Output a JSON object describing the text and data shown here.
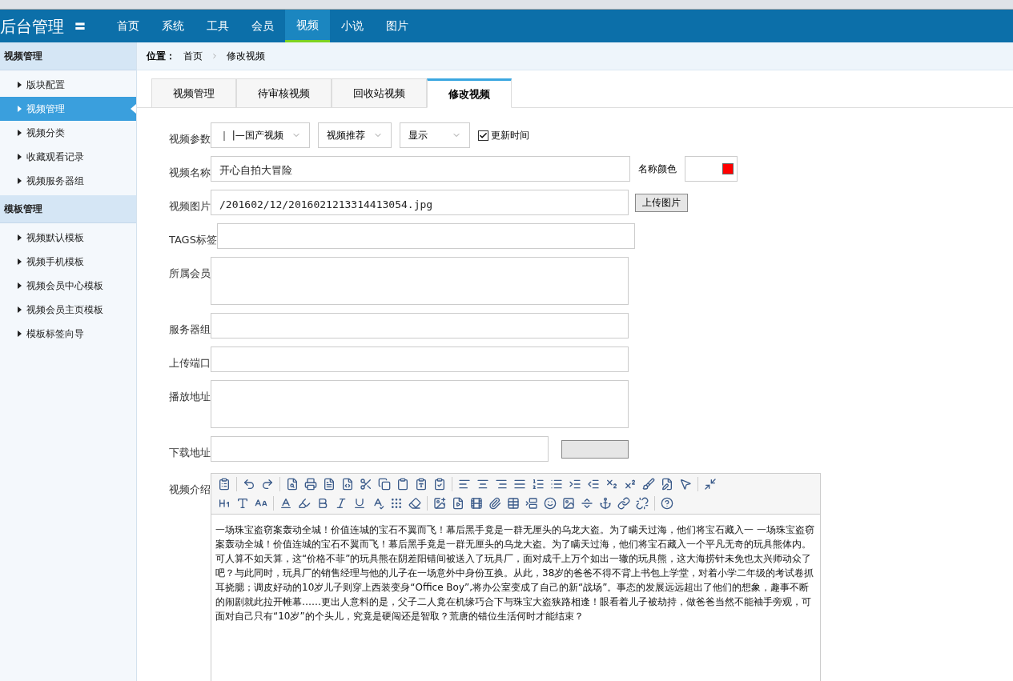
{
  "header": {
    "logo": "后台管理",
    "menu_glyph": "〓",
    "nav": [
      {
        "label": "首页",
        "selected": false
      },
      {
        "label": "系统",
        "selected": false
      },
      {
        "label": "工具",
        "selected": false
      },
      {
        "label": "会员",
        "selected": false
      },
      {
        "label": "视频",
        "selected": true
      },
      {
        "label": "小说",
        "selected": false
      },
      {
        "label": "图片",
        "selected": false
      }
    ]
  },
  "sidebar": [
    {
      "title": "视频管理",
      "items": [
        {
          "label": "版块配置",
          "selected": false
        },
        {
          "label": "视频管理",
          "selected": true
        },
        {
          "label": "视频分类",
          "selected": false
        },
        {
          "label": "收藏观看记录",
          "selected": false
        },
        {
          "label": "视频服务器组",
          "selected": false
        }
      ]
    },
    {
      "title": "模板管理",
      "items": [
        {
          "label": "视频默认模板",
          "selected": false
        },
        {
          "label": "视频手机模板",
          "selected": false
        },
        {
          "label": "视频会员中心模板",
          "selected": false
        },
        {
          "label": "视频会员主页模板",
          "selected": false
        },
        {
          "label": "模板标签向导",
          "selected": false
        }
      ]
    }
  ],
  "breadcrumb": {
    "label": "位置：",
    "items": [
      "首页",
      "修改视频"
    ]
  },
  "tabs": [
    {
      "label": "视频管理",
      "selected": false
    },
    {
      "label": "待审核视频",
      "selected": false
    },
    {
      "label": "回收站视频",
      "selected": false
    },
    {
      "label": "修改视频",
      "selected": true
    }
  ],
  "form": [
    {
      "kind": "selects",
      "label": "视频参数",
      "selects": [
        "｜ |—国产视频",
        "视频推荐",
        "显示"
      ],
      "checkbox": {
        "label": "更新时间",
        "checked": true
      }
    },
    {
      "kind": "color",
      "label": "视频名称",
      "value": "开心自拍大冒险",
      "color_label": "名称颜色",
      "color": "#ff0000"
    },
    {
      "kind": "upload",
      "label": "视频图片",
      "value": "/201602/12/2016021213314413054.jpg",
      "button": "上传图片"
    },
    {
      "kind": "text",
      "label": "TAGS标签"
    },
    {
      "kind": "tall",
      "label": "所属会员"
    },
    {
      "kind": "text",
      "label": "服务器组"
    },
    {
      "kind": "text",
      "label": "上传端口"
    },
    {
      "kind": "tall",
      "label": "播放地址"
    },
    {
      "kind": "download",
      "label": "下载地址"
    }
  ],
  "editor": {
    "label": "视频介绍",
    "content": "一场珠宝盗窃案轰动全城！价值连城的宝石不翼而飞！幕后黑手竟是一群无厘头的乌龙大盗。为了瞒天过海，他们将宝石藏入一 一场珠宝盗窃案轰动全城！价值连城的宝石不翼而飞！幕后黑手竟是一群无厘头的乌龙大盗。为了瞒天过海，他们将宝石藏入一个平凡无奇的玩具熊体内。可人算不如天算，这“价格不菲”的玩具熊在阴差阳错间被送入了玩具厂，面对成千上万个如出一辙的玩具熊，这大海捞针未免也太兴师动众了吧？与此同时，玩具厂的销售经理与他的儿子在一场意外中身份互换。从此，38岁的爸爸不得不背上书包上学堂，对着小学二年级的考试卷抓耳挠腮；调皮好动的10岁儿子则穿上西装变身“Office Boy”,将办公室变成了自己的新“战场”。事态的发展远远超出了他们的想象，趣事不断的闹剧就此拉开帷幕……更出人意料的是，父子二人竟在机缘巧合下与珠宝大盗狭路相逢！眼看着儿子被劫持，做爸爸当然不能袖手旁观，可面对自己只有“10岁”的个头儿，究竟是硬闯还是智取？荒唐的错位生活何时才能结束？"
  }
}
